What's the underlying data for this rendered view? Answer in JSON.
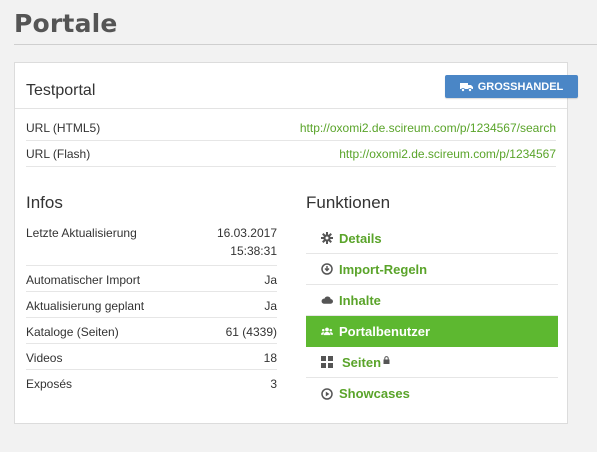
{
  "page": {
    "title": "Portale"
  },
  "portal": {
    "name": "Testportal",
    "badge_label": "GROSSHANDEL",
    "urls": [
      {
        "label": "URL (HTML5)",
        "value": "http://oxomi2.de.scireum.com/p/1234567/search"
      },
      {
        "label": "URL (Flash)",
        "value": "http://oxomi2.de.scireum.com/p/1234567"
      }
    ]
  },
  "infos": {
    "title": "Infos",
    "rows": [
      {
        "label": "Letzte Aktualisierung",
        "value": "16.03.2017",
        "value2": "15:38:31"
      },
      {
        "label": "Automatischer Import",
        "value": "Ja"
      },
      {
        "label": "Aktualisierung geplant",
        "value": "Ja"
      },
      {
        "label": "Kataloge (Seiten)",
        "value": "61 (4339)"
      },
      {
        "label": "Videos",
        "value": "18"
      },
      {
        "label": "Exposés",
        "value": "3"
      }
    ]
  },
  "funktionen": {
    "title": "Funktionen",
    "items": [
      {
        "label": "Details",
        "icon": "gear-icon"
      },
      {
        "label": "Import-Regeln",
        "icon": "download-circle-icon"
      },
      {
        "label": "Inhalte",
        "icon": "cloud-icon"
      },
      {
        "label": "Portalbenutzer",
        "icon": "users-icon",
        "active": true
      },
      {
        "label": "Seiten",
        "icon": "grid-icon",
        "locked": true
      },
      {
        "label": "Showcases",
        "icon": "play-circle-icon"
      }
    ]
  },
  "colors": {
    "accent_green": "#5aa42a",
    "active_green": "#5db830",
    "badge_blue": "#4a86c6"
  }
}
